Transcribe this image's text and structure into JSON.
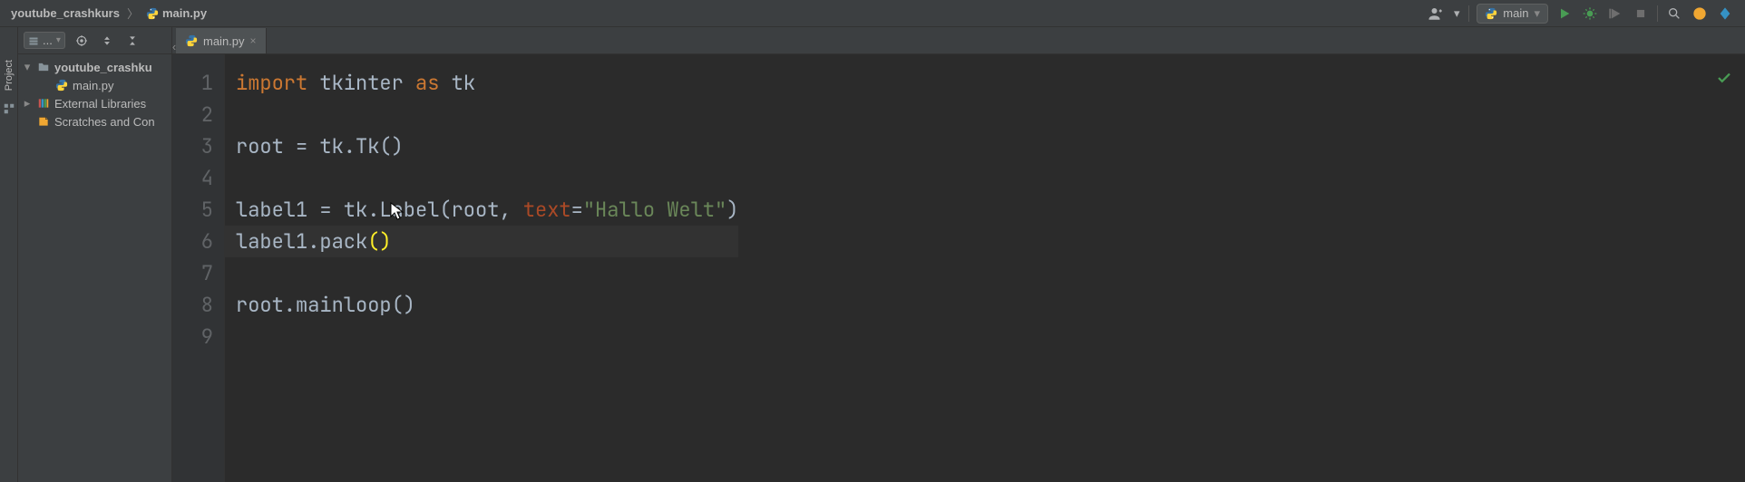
{
  "breadcrumbs": {
    "project": "youtube_crashkurs",
    "file": "main.py"
  },
  "runConfig": {
    "label": "main"
  },
  "projectTree": {
    "root": "youtube_crashku",
    "file": "main.py",
    "external": "External Libraries",
    "scratches": "Scratches and Con"
  },
  "tabs": {
    "active": "main.py"
  },
  "gutter": {
    "lines": [
      "1",
      "2",
      "3",
      "4",
      "5",
      "6",
      "7",
      "8",
      "9"
    ]
  },
  "code": {
    "l1": {
      "kw": "import",
      "mod": " tkinter ",
      "kw2": "as",
      "alias": " tk"
    },
    "l3": {
      "lhs": "root = tk.Tk()"
    },
    "l5": {
      "lhs": "label1 = tk.Label(root",
      "comma": ", ",
      "param": "text",
      "eq": "=",
      "str": "\"Hallo Welt\"",
      "rparen": ")"
    },
    "l6": {
      "lhs": "label1.pack",
      "lp": "(",
      "rp": ")"
    },
    "l8": {
      "lhs": "root.mainloop()"
    }
  },
  "leftGutter": {
    "projectLabel": "Project"
  },
  "toolbarSelect": "..."
}
